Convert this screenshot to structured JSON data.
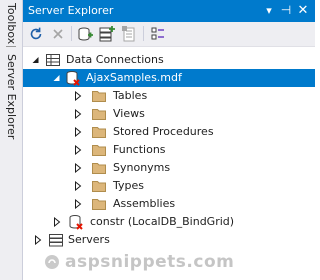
{
  "sidebar": {
    "toolbox_label": "Toolbox",
    "server_explorer_label": "Server Explorer"
  },
  "panel": {
    "title": "Server Explorer",
    "buttons": {
      "dropdown": "▾",
      "pin": "⊣",
      "close": "✕"
    }
  },
  "toolbar": {
    "icons": [
      "refresh-icon",
      "stop-icon",
      "connect-to-database-icon",
      "connect-to-server-icon",
      "properties-icon",
      "filter-icon"
    ]
  },
  "tree": {
    "data_connections": "Data Connections",
    "database": "AjaxSamples.mdf",
    "folders": [
      "Tables",
      "Views",
      "Stored Procedures",
      "Functions",
      "Synonyms",
      "Types",
      "Assemblies"
    ],
    "second_connection": "constr (LocalDB_BindGrid)",
    "servers": "Servers"
  },
  "watermark": "aspsnippets.com",
  "colors": {
    "accent": "#007acc",
    "folder": "#dcb67a",
    "error": "#e51400"
  }
}
